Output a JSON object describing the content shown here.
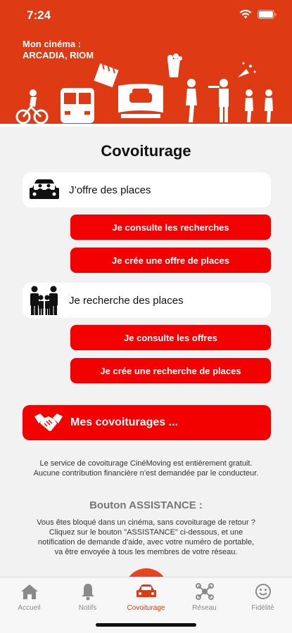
{
  "status_bar": {
    "time": "7:24"
  },
  "header": {
    "cinema_label": "Mon cinéma :",
    "cinema_name": "ARCADIA, RIOM"
  },
  "page": {
    "title": "Covoiturage"
  },
  "offer_section": {
    "label": "J’offre des places",
    "icon": "car-passengers-icon",
    "buttons": [
      "Je consulte les recherches",
      "Je crée une offre de places"
    ]
  },
  "search_section": {
    "label": "Je recherche des places",
    "icon": "family-icon",
    "buttons": [
      "Je consulte les offres",
      "Je crée une recherche de places"
    ]
  },
  "my_carpools": {
    "label": "Mes covoiturages ...",
    "icon": "handshake-icon"
  },
  "info": {
    "line1": "Le service de covoiturage CinéMoving est entièrement gratuit.",
    "line2": "Aucune contribution financière n’est demandée par le conducteur."
  },
  "assistance": {
    "title": "Bouton ASSISTANCE :",
    "lines": [
      "Vous êtes bloqué dans un cinéma, sans covoiturage de retour ?",
      "Cliquez sur le bouton \"ASSISTANCE\" ci-dessous, et une",
      "notification de demande d'aide, avec votre numéro de portable,",
      "va être envoyée à tous les membres de votre réseau."
    ]
  },
  "tabs": [
    {
      "label": "Accueil",
      "icon": "home-icon"
    },
    {
      "label": "Notifs",
      "icon": "bell-icon"
    },
    {
      "label": "Covoiturage",
      "icon": "car-icon",
      "active": true
    },
    {
      "label": "Réseau",
      "icon": "network-icon"
    },
    {
      "label": "Fidélité",
      "icon": "smiley-icon"
    }
  ],
  "colors": {
    "header": "#de3a14",
    "button": "#f30000",
    "active_tab": "#e03a14"
  }
}
